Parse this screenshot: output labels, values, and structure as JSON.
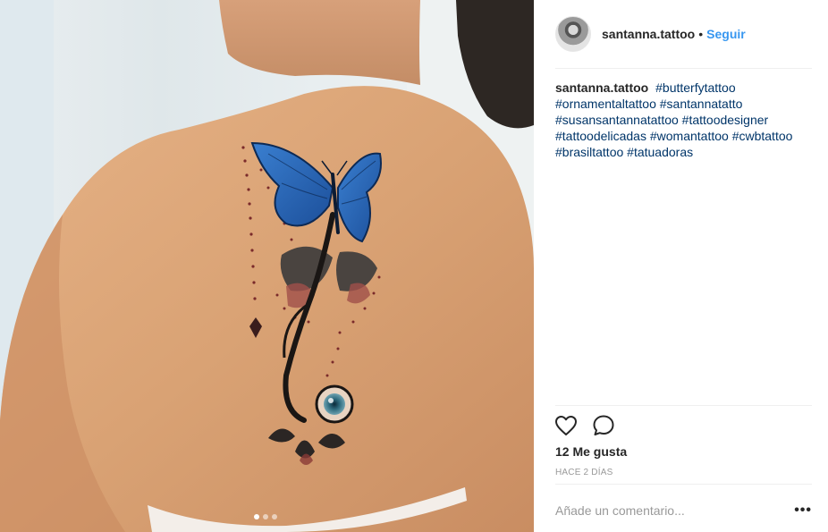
{
  "post": {
    "username": "santanna.tattoo",
    "follow_label": "Seguir",
    "separator": "•",
    "caption": {
      "username": "santanna.tattoo",
      "hashtags": [
        "#butterfytattoo",
        "#ornamentaltattoo",
        "#santannatatto",
        "#susansantannatattoo",
        "#tattoodesigner",
        "#tattoodelicadas",
        "#womantattoo",
        "#cwbtattoo",
        "#brasiltattoo",
        "#tatuadoras"
      ]
    },
    "likes_text": "12 Me gusta",
    "time_text": "HACE 2 DÍAS",
    "comment_placeholder": "Añade un comentario...",
    "more_label": "•••"
  },
  "carousel": {
    "count": 3,
    "active": 1
  },
  "icons": {
    "like": "heart-icon",
    "comment": "comment-bubble-icon",
    "more": "more-options-icon"
  },
  "colors": {
    "link": "#3897f0",
    "hashtag": "#003569",
    "muted": "#999999",
    "divider": "#efefef"
  }
}
